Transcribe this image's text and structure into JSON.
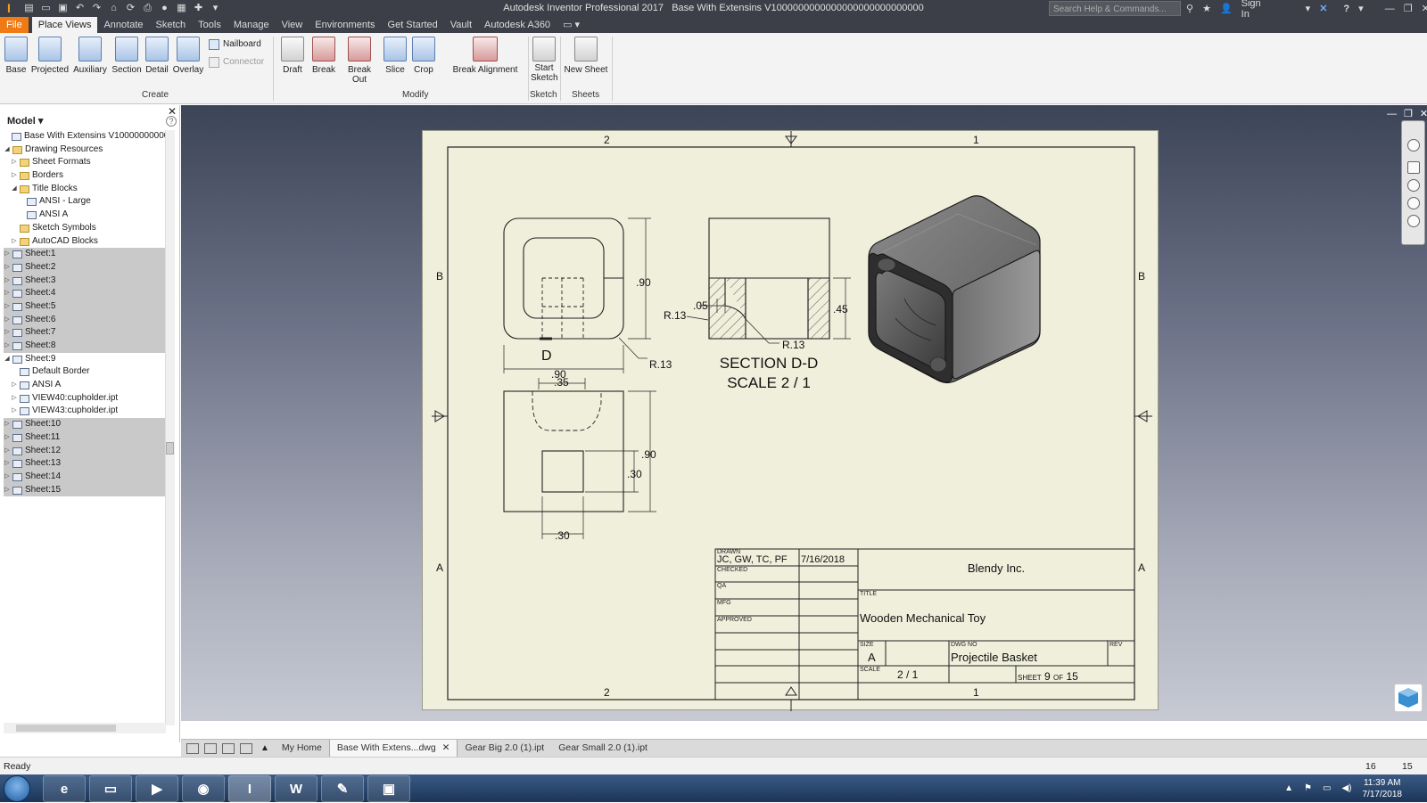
{
  "app": {
    "window_title": "Autodesk Inventor Professional 2017",
    "document_title": "Base With Extensins V1000000000000000000000000000",
    "search_placeholder": "Search Help & Commands...",
    "sign_in": "Sign In",
    "help": "?"
  },
  "menu": {
    "tabs": [
      "File",
      "Place Views",
      "Annotate",
      "Sketch",
      "Tools",
      "Manage",
      "View",
      "Environments",
      "Get Started",
      "Vault",
      "Autodesk A360"
    ],
    "active": "Place Views"
  },
  "ribbon": {
    "create": {
      "label": "Create",
      "buttons": [
        "Base",
        "Projected",
        "Auxiliary",
        "Section",
        "Detail",
        "Overlay"
      ],
      "small": [
        "Nailboard",
        "Connector"
      ]
    },
    "modify": {
      "label": "Modify",
      "buttons": [
        "Draft",
        "Break",
        "Break Out",
        "Slice",
        "Crop",
        "Break Alignment"
      ]
    },
    "sketch": {
      "label": "Sketch",
      "button_line1": "Start",
      "button_line2": "Sketch"
    },
    "sheets": {
      "label": "Sheets",
      "button": "New Sheet"
    }
  },
  "browser": {
    "header": "Model",
    "help": "?",
    "close": "✕",
    "root": "Base With Extensins V10000000000000",
    "nodes": [
      {
        "label": "Drawing Resources",
        "indent": 1,
        "exp": "◢",
        "folder": true,
        "sel": false
      },
      {
        "label": "Sheet Formats",
        "indent": 2,
        "exp": "▷",
        "folder": true,
        "sel": false
      },
      {
        "label": "Borders",
        "indent": 2,
        "exp": "▷",
        "folder": true,
        "sel": false
      },
      {
        "label": "Title Blocks",
        "indent": 2,
        "exp": "◢",
        "folder": true,
        "sel": false
      },
      {
        "label": "ANSI - Large",
        "indent": 3,
        "exp": "",
        "folder": false,
        "sel": false
      },
      {
        "label": "ANSI A",
        "indent": 3,
        "exp": "",
        "folder": false,
        "sel": false
      },
      {
        "label": "Sketch Symbols",
        "indent": 2,
        "exp": "",
        "folder": true,
        "sel": false
      },
      {
        "label": "AutoCAD Blocks",
        "indent": 2,
        "exp": "▷",
        "folder": true,
        "sel": false
      },
      {
        "label": "Sheet:1",
        "indent": 1,
        "exp": "▷",
        "folder": false,
        "sel": true
      },
      {
        "label": "Sheet:2",
        "indent": 1,
        "exp": "▷",
        "folder": false,
        "sel": true
      },
      {
        "label": "Sheet:3",
        "indent": 1,
        "exp": "▷",
        "folder": false,
        "sel": true
      },
      {
        "label": "Sheet:4",
        "indent": 1,
        "exp": "▷",
        "folder": false,
        "sel": true
      },
      {
        "label": "Sheet:5",
        "indent": 1,
        "exp": "▷",
        "folder": false,
        "sel": true
      },
      {
        "label": "Sheet:6",
        "indent": 1,
        "exp": "▷",
        "folder": false,
        "sel": true
      },
      {
        "label": "Sheet:7",
        "indent": 1,
        "exp": "▷",
        "folder": false,
        "sel": true
      },
      {
        "label": "Sheet:8",
        "indent": 1,
        "exp": "▷",
        "folder": false,
        "sel": true
      },
      {
        "label": "Sheet:9",
        "indent": 1,
        "exp": "◢",
        "folder": false,
        "sel": false
      },
      {
        "label": "Default Border",
        "indent": 2,
        "exp": "",
        "folder": false,
        "sel": false
      },
      {
        "label": "ANSI A",
        "indent": 2,
        "exp": "▷",
        "folder": false,
        "sel": false
      },
      {
        "label": "VIEW40:cupholder.ipt",
        "indent": 2,
        "exp": "▷",
        "folder": false,
        "sel": false
      },
      {
        "label": "VIEW43:cupholder.ipt",
        "indent": 2,
        "exp": "▷",
        "folder": false,
        "sel": false
      },
      {
        "label": "Sheet:10",
        "indent": 1,
        "exp": "▷",
        "folder": false,
        "sel": true
      },
      {
        "label": "Sheet:11",
        "indent": 1,
        "exp": "▷",
        "folder": false,
        "sel": true
      },
      {
        "label": "Sheet:12",
        "indent": 1,
        "exp": "▷",
        "folder": false,
        "sel": true
      },
      {
        "label": "Sheet:13",
        "indent": 1,
        "exp": "▷",
        "folder": false,
        "sel": true
      },
      {
        "label": "Sheet:14",
        "indent": 1,
        "exp": "▷",
        "folder": false,
        "sel": true
      },
      {
        "label": "Sheet:15",
        "indent": 1,
        "exp": "▷",
        "folder": false,
        "sel": true
      }
    ]
  },
  "drawing": {
    "zones": {
      "top": [
        "2",
        "1"
      ],
      "side": [
        "B",
        "A"
      ]
    },
    "dims": {
      "h90": ".90",
      "w90": ".90",
      "r13a": "R.13",
      "d_label": "D",
      "w35": ".35",
      "h90b": ".90",
      "h30": ".30",
      "w30": ".30",
      "w05": ".05",
      "r13b": "R.13",
      "r13c": "R.13",
      "h45": ".45"
    },
    "section_title": "SECTION D-D",
    "section_scale": "SCALE 2 / 1",
    "title_block": {
      "drawn_label": "DRAWN",
      "drawn_by": "JC, GW, TC, PF",
      "drawn_date": "7/16/2018",
      "checked_label": "CHECKED",
      "qa_label": "QA",
      "mfg_label": "MFG",
      "approved_label": "APPROVED",
      "company": "Blendy Inc.",
      "title_label": "TITLE",
      "title": "Wooden Mechanical Toy",
      "size_label": "SIZE",
      "size": "A",
      "dwg_no_label": "DWG NO",
      "dwg_no": "Projectile Basket",
      "rev_label": "REV",
      "scale_label": "SCALE",
      "scale": "2 / 1",
      "sheet_label": "SHEET",
      "sheet_no": "9",
      "of_label": "OF",
      "sheet_total": "15"
    }
  },
  "doc_tabs": {
    "items": [
      "My Home",
      "Base With Extens...dwg",
      "Gear Big 2.0 (1).ipt",
      "Gear Small 2.0 (1).ipt"
    ],
    "active": "Base With Extens...dwg",
    "close": "✕"
  },
  "status": {
    "text": "Ready",
    "val1": "16",
    "val2": "15"
  },
  "taskbar": {
    "time": "11:39 AM",
    "date": "7/17/2018"
  }
}
